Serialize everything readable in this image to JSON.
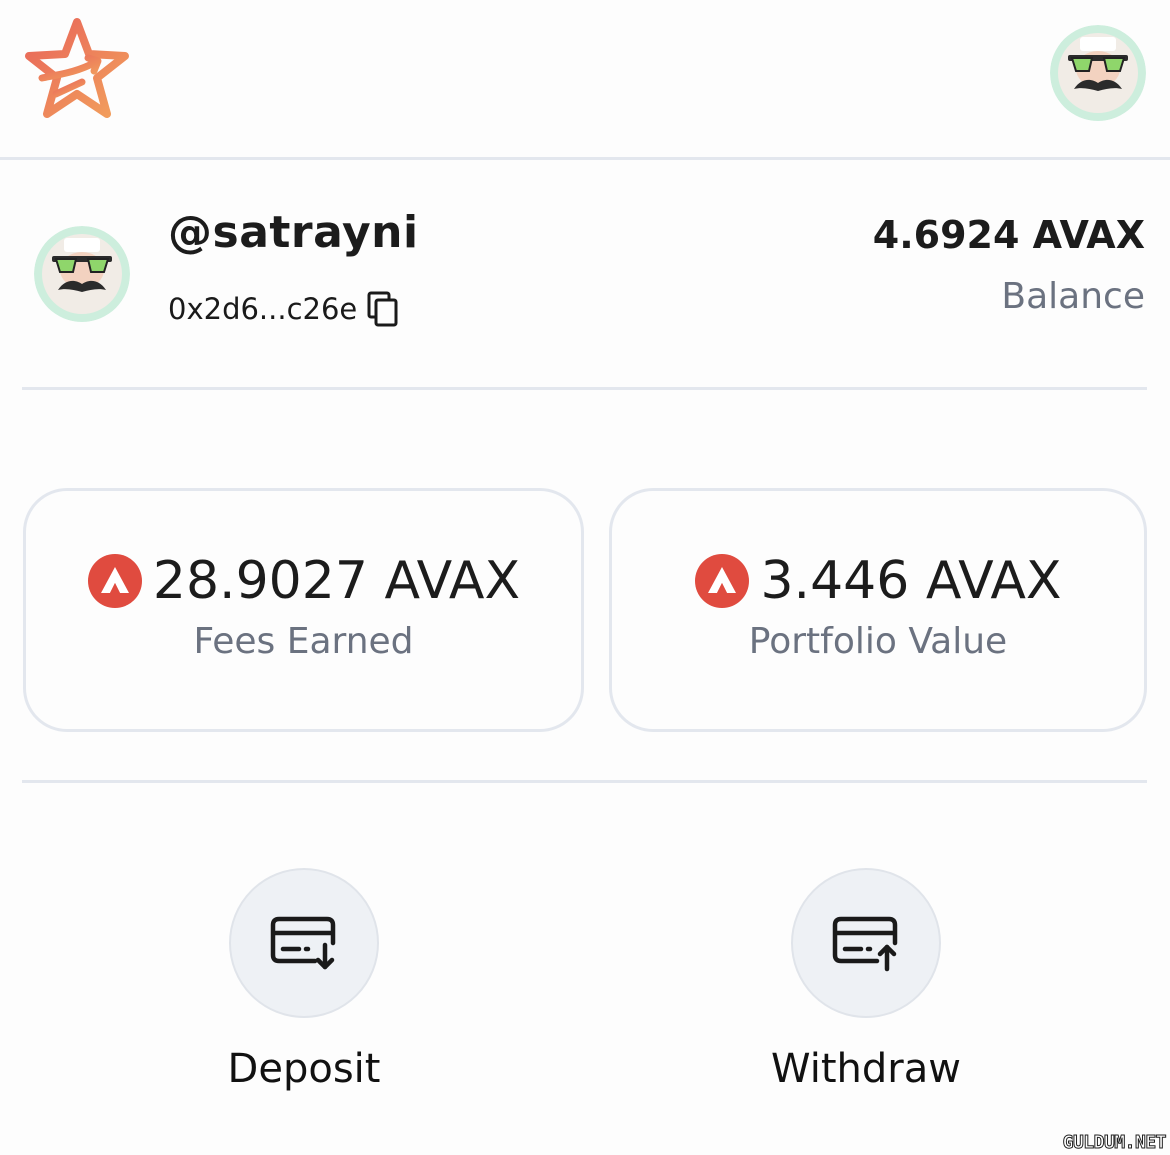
{
  "header": {
    "logo_icon": "star-arrow-logo-icon",
    "avatar_icon": "mustache-sunglasses-avatar-icon"
  },
  "profile": {
    "username": "@satrayni",
    "address": "0x2d6...c26e",
    "copy_icon": "copy-icon",
    "balance_value": "4.6924 AVAX",
    "balance_label": "Balance"
  },
  "stats": [
    {
      "value": "28.9027 AVAX",
      "label": "Fees Earned",
      "icon": "avax-icon"
    },
    {
      "value": "3.446 AVAX",
      "label": "Portfolio Value",
      "icon": "avax-icon"
    }
  ],
  "actions": [
    {
      "label": "Deposit",
      "icon": "card-deposit-icon"
    },
    {
      "label": "Withdraw",
      "icon": "card-withdraw-icon"
    }
  ],
  "watermark": "GULDUM.NET",
  "colors": {
    "logo_gradient_start": "#e8645a",
    "logo_gradient_end": "#f2a15c",
    "avax_red": "#e04b3f",
    "muted_text": "#6b7280",
    "divider": "#e3e7ee",
    "action_circle": "#eef1f5"
  }
}
